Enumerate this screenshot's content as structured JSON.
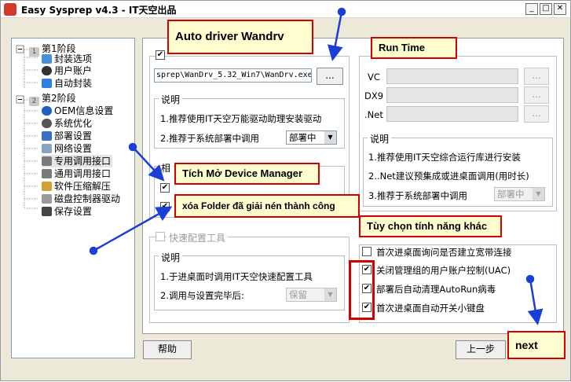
{
  "window": {
    "title": "Easy Sysprep v4.3 - IT天空出品",
    "controls": [
      "_",
      "□",
      "✕"
    ]
  },
  "sidebar": {
    "items": [
      {
        "label": "第1阶段",
        "num": "1",
        "icon": "stage-icon"
      },
      {
        "label": "封装选项",
        "icon": "monitor-icon"
      },
      {
        "label": "用户账户",
        "icon": "user-icon"
      },
      {
        "label": "自动封装",
        "icon": "arrow-icon"
      },
      {
        "label": "第2阶段",
        "num": "2",
        "icon": "stage-icon"
      },
      {
        "label": "OEM信息设置",
        "icon": "info-icon"
      },
      {
        "label": "系统优化",
        "icon": "gear-icon"
      },
      {
        "label": "部署设置",
        "icon": "deploy-icon"
      },
      {
        "label": "网络设置",
        "icon": "network-icon"
      },
      {
        "label": "专用调用接口",
        "icon": "interface-icon"
      },
      {
        "label": "通用调用接口",
        "icon": "interface-icon"
      },
      {
        "label": "软件压缩解压",
        "icon": "archive-icon"
      },
      {
        "label": "磁盘控制器驱动",
        "icon": "disk-icon"
      },
      {
        "label": "保存设置",
        "icon": "save-icon"
      }
    ]
  },
  "driver": {
    "path": "sprep\\WanDrv_5.32_Win7\\WanDrv.exe",
    "browse": "...",
    "desc_title": "说明",
    "desc1": "1.推荐使用IT天空万能驱动助理安装驱动",
    "desc2": "2.推荐于系统部署中调用",
    "select": "部署中"
  },
  "related": {
    "label": "相"
  },
  "quickconf": {
    "label": "快速配置工具",
    "desc_title": "说明",
    "desc1": "1.于进桌面时调用IT天空快速配置工具",
    "desc2": "2.调用与设置完毕后:",
    "select": "保留"
  },
  "runtime": {
    "rows": [
      "VC",
      "DX9",
      ".Net"
    ],
    "browse": "...",
    "desc_title": "说明",
    "desc1": "1.推荐使用IT天空综合运行库进行安装",
    "desc2": "2..Net建议预集成或进桌面调用(用时长)",
    "desc3": "3.推荐于系统部署中调用",
    "select": "部署中"
  },
  "options": [
    {
      "label": "首次进桌面询问是否建立宽带连接",
      "checked": false
    },
    {
      "label": "关闭管理组的用户账户控制(UAC)",
      "checked": true
    },
    {
      "label": "部署后自动清理AutoRun病毒",
      "checked": true
    },
    {
      "label": "首次进桌面自动开关小键盘",
      "checked": true
    }
  ],
  "footer": {
    "help": "帮助",
    "prev": "上一步"
  },
  "annotations": {
    "auto_driver": "Auto driver Wandrv",
    "run_time": "Run Time",
    "device_manager": "Tích Mở Device Manager",
    "delete_folder": "xóa Folder đã giải nén thành công",
    "other_options": "Tùy chọn tính năng khác",
    "next": "next"
  },
  "colors": {
    "callout_border": "#d40000",
    "callout_fill": "#fffdd0",
    "arrow": "#1a3fd6"
  }
}
